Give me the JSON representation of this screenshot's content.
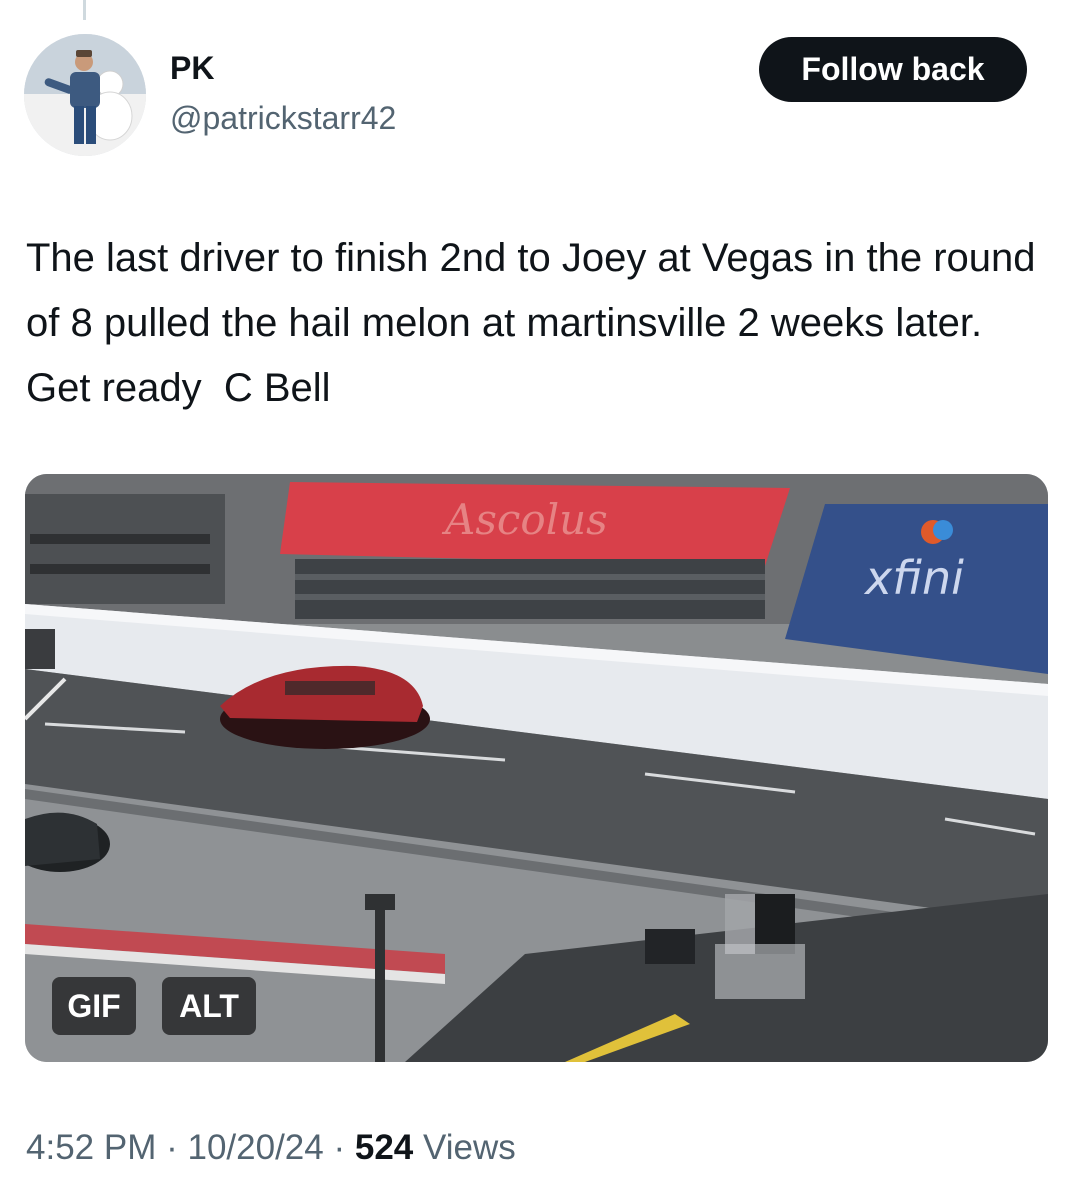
{
  "author": {
    "display_name": "PK",
    "handle": "@patrickstarr42",
    "avatar_icon": "user-avatar-photo"
  },
  "follow_button": {
    "label": "Follow back"
  },
  "tweet": {
    "text": "The last driver to finish 2nd to Joey at Vegas in the round of 8 pulled the hail melon at martinsville 2 weeks later. Get ready  C Bell"
  },
  "media": {
    "type": "gif",
    "gif_badge": "GIF",
    "alt_badge": "ALT",
    "sponsor_sign": "xfini"
  },
  "meta": {
    "time": "4:52 PM",
    "separator": "·",
    "date": "10/20/24",
    "views_count": "524",
    "views_label": "Views"
  },
  "colors": {
    "text_primary": "#0f1419",
    "text_secondary": "#536471",
    "button_bg": "#0f1419",
    "button_text": "#ffffff"
  }
}
